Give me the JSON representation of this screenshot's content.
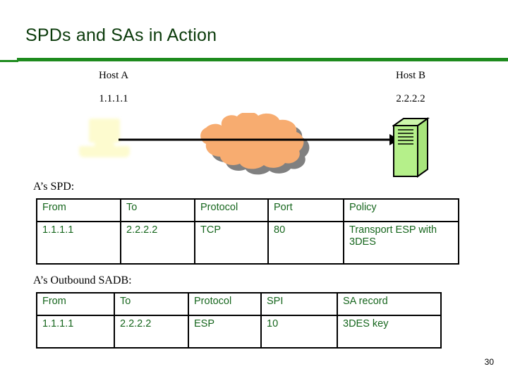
{
  "slide": {
    "title": "SPDs and SAs in Action",
    "page_number": "30",
    "accent_color": "#1e8b1e",
    "title_color": "#0b3b0b",
    "table_text_color": "#16661d"
  },
  "diagram": {
    "host_a": {
      "name": "Host A",
      "ip": "1.1.1.1",
      "icon": "computer-icon",
      "icon_color": "#fdfbcd"
    },
    "host_b": {
      "name": "Host B",
      "ip": "2.2.2.2",
      "icon": "server-icon",
      "icon_color": "#b5f08a"
    },
    "cloud": {
      "icon": "network-cloud-icon",
      "color": "#f7ac70",
      "shadow_color": "#808080"
    },
    "arrow": {
      "icon": "arrow-right-icon",
      "color": "#000000",
      "direction": "left-to-right"
    }
  },
  "spd": {
    "caption": "A’s SPD:",
    "headers": [
      "From",
      "To",
      "Protocol",
      "Port",
      "Policy"
    ],
    "rows": [
      [
        "1.1.1.1",
        "2.2.2.2",
        "TCP",
        "80",
        "Transport ESP with 3DES"
      ]
    ]
  },
  "sadb": {
    "caption": "A’s Outbound SADB:",
    "headers": [
      "From",
      "To",
      "Protocol",
      "SPI",
      "SA record"
    ],
    "rows": [
      [
        "1.1.1.1",
        "2.2.2.2",
        "ESP",
        "10",
        "3DES key"
      ]
    ]
  }
}
